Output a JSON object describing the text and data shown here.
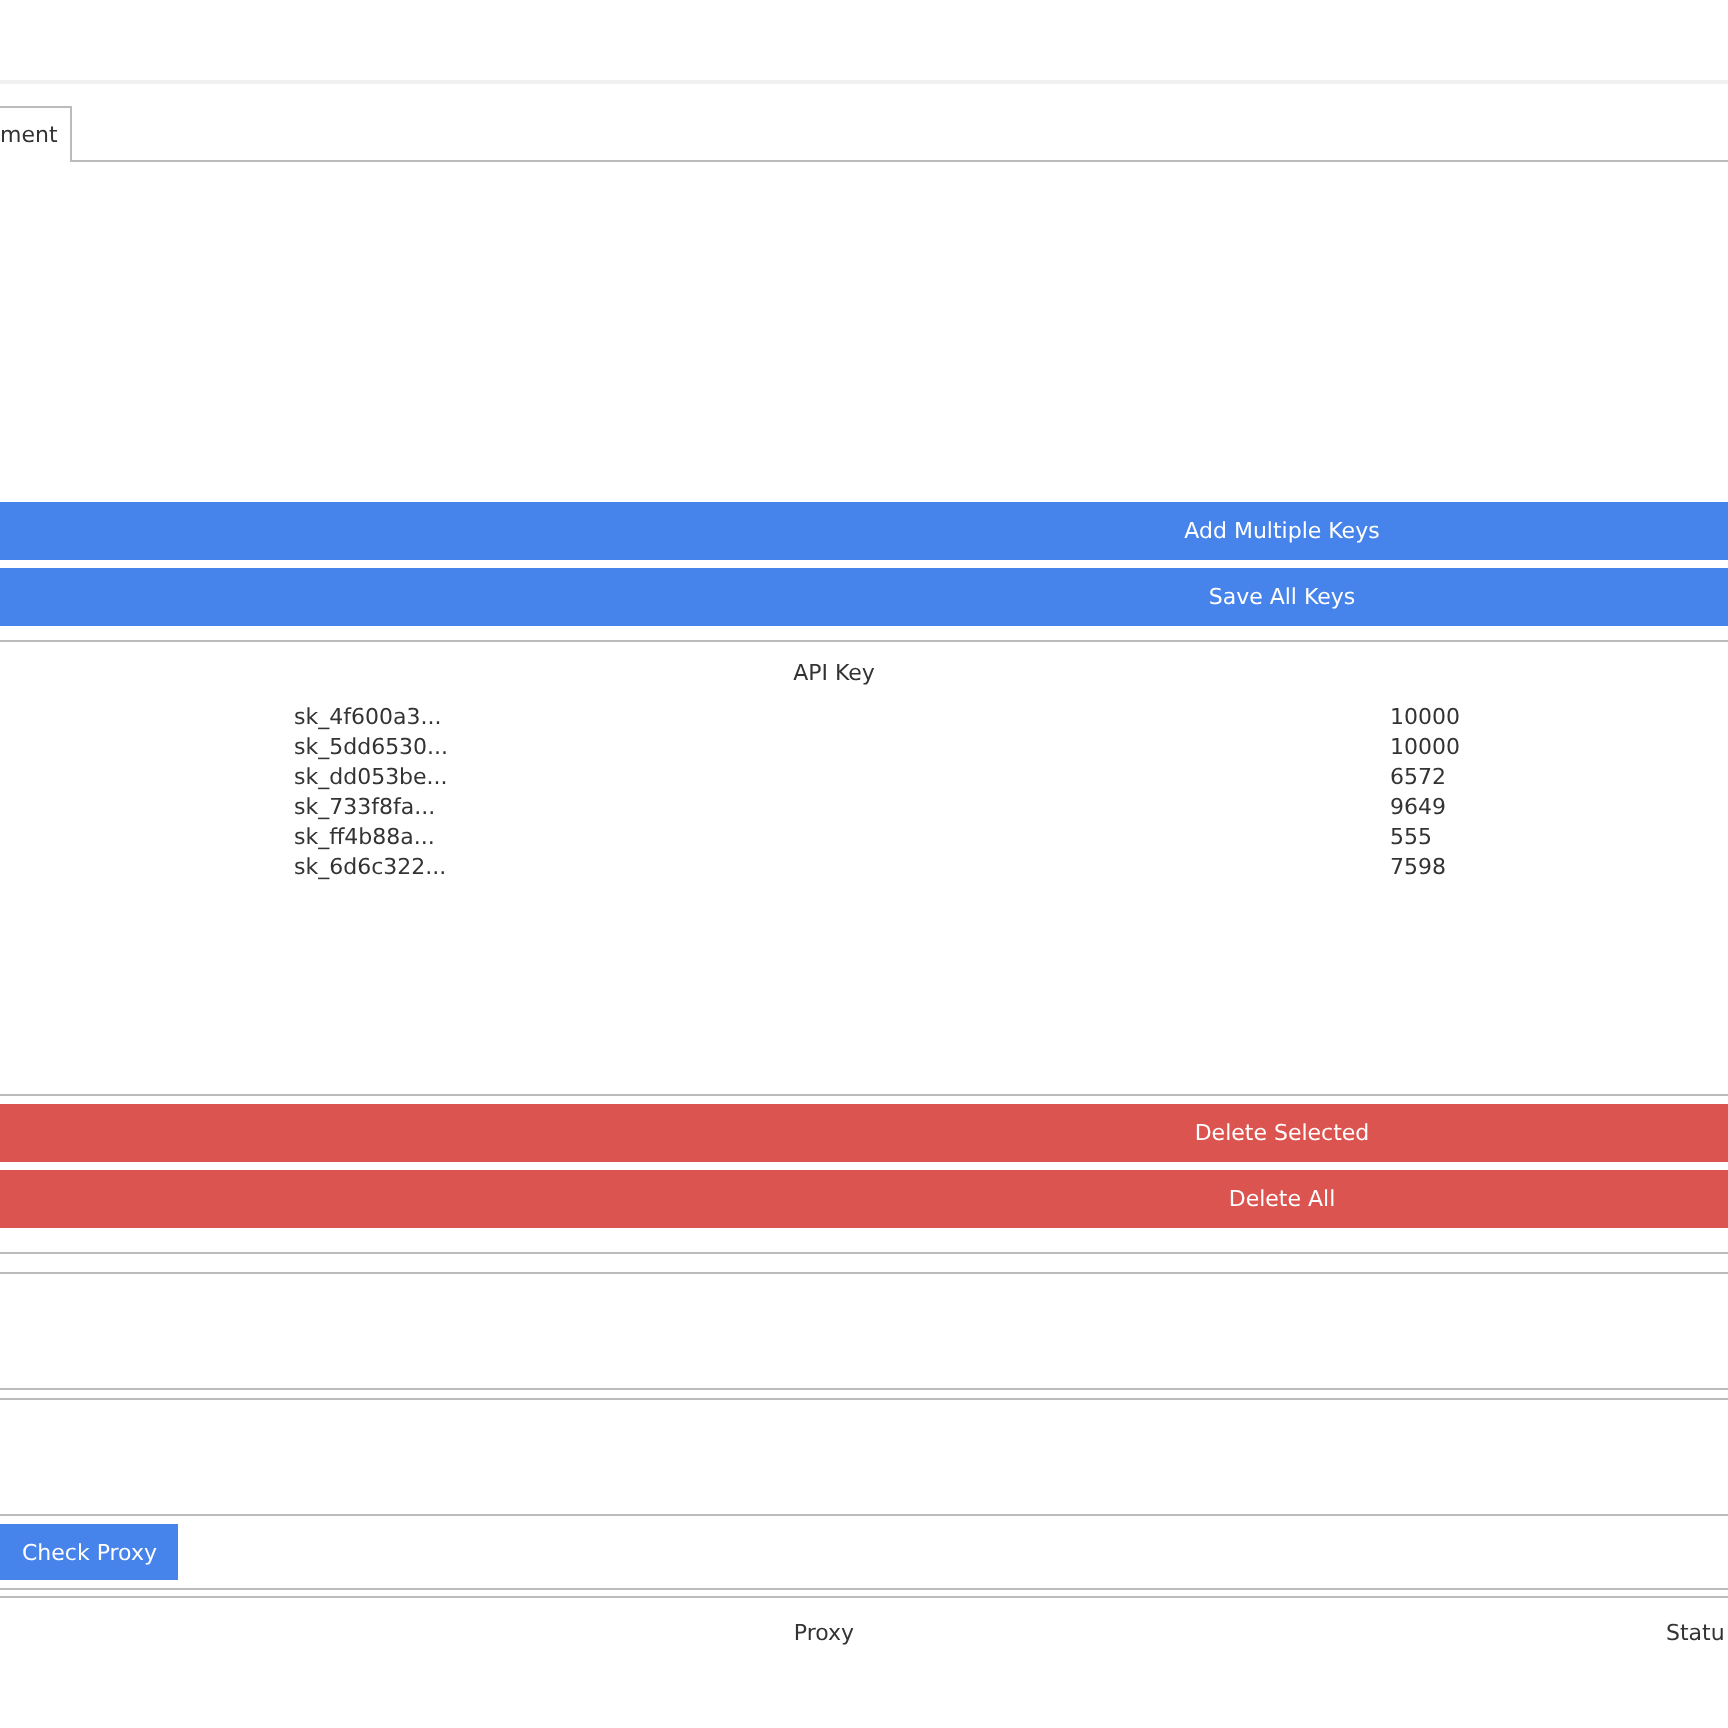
{
  "tabs": [
    {
      "label": "ment",
      "selected": true
    }
  ],
  "key_buttons": [
    {
      "label": "Add Multiple Keys",
      "kind": "primary"
    },
    {
      "label": "Save All Keys",
      "kind": "primary"
    }
  ],
  "key_table": {
    "columns": [
      "API Key"
    ],
    "rows": [
      {
        "api_key": "sk_4f600a3...",
        "column_2": "10000"
      },
      {
        "api_key": "sk_5dd6530...",
        "column_2": "10000"
      },
      {
        "api_key": "sk_dd053be...",
        "column_2": "6572"
      },
      {
        "api_key": "sk_733f8fa...",
        "column_2": "9649"
      },
      {
        "api_key": "sk_ff4b88a...",
        "column_2": "555"
      },
      {
        "api_key": "sk_6d6c322...",
        "column_2": "7598"
      }
    ]
  },
  "delete_buttons": [
    {
      "label": "Delete Selected",
      "kind": "danger"
    },
    {
      "label": "Delete All",
      "kind": "danger"
    }
  ],
  "proxy_button": {
    "label": "Check Proxy",
    "kind": "primary"
  },
  "proxy_table": {
    "columns": [
      "Proxy",
      "Statu"
    ]
  }
}
